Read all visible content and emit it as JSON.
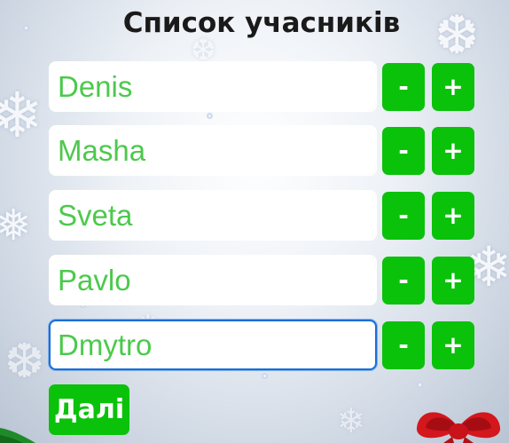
{
  "title": "Список учасників",
  "participants": [
    {
      "name": "Denis"
    },
    {
      "name": "Masha"
    },
    {
      "name": "Sveta"
    },
    {
      "name": "Pavlo"
    },
    {
      "name": "Dmytro"
    }
  ],
  "buttons": {
    "minus_label": "-",
    "plus_label": "+",
    "next_label": "Далі"
  },
  "colors": {
    "accent": "#0ac20a",
    "input_text": "#4cc94c",
    "focus_border": "#1a6fd6"
  }
}
